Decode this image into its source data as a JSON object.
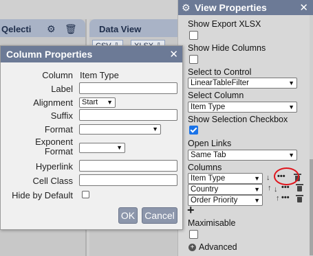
{
  "left_panel": {
    "fragment_text": "Qelecti"
  },
  "data_view": {
    "title": "Data View",
    "buttons": [
      "CSV ⇩",
      "XLSX ⇩"
    ]
  },
  "view_properties": {
    "title": "View Properties",
    "show_export_xlsx": {
      "label": "Show Export XLSX",
      "checked": false
    },
    "show_hide_columns": {
      "label": "Show Hide Columns",
      "checked": false
    },
    "select_to_control": {
      "label": "Select to Control",
      "value": "LinearTableFilter"
    },
    "select_column": {
      "label": "Select Column",
      "value": "Item Type"
    },
    "show_selection_checkbox": {
      "label": "Show Selection Checkbox",
      "checked": true
    },
    "open_links": {
      "label": "Open Links",
      "value": "Same Tab"
    },
    "columns": {
      "label": "Columns",
      "items": [
        {
          "value": "Item Type"
        },
        {
          "value": "Country"
        },
        {
          "value": "Order Priority"
        }
      ]
    },
    "maximisable": {
      "label": "Maximisable",
      "checked": false
    },
    "advanced": {
      "label": "Advanced"
    },
    "annotation_color": "#e0141c",
    "header_color": "#6c7a96"
  },
  "column_properties": {
    "title": "Column Properties",
    "column": {
      "label": "Column",
      "value": "Item Type"
    },
    "label": {
      "label": "Label",
      "value": ""
    },
    "alignment": {
      "label": "Alignment",
      "value": "Start"
    },
    "suffix": {
      "label": "Suffix",
      "value": ""
    },
    "format": {
      "label": "Format",
      "value": ""
    },
    "exponent_format": {
      "label_line1": "Exponent",
      "label_line2": "Format",
      "value": ""
    },
    "hyperlink": {
      "label": "Hyperlink",
      "value": ""
    },
    "cell_class": {
      "label": "Cell Class",
      "value": ""
    },
    "hide_by_default": {
      "label": "Hide by Default",
      "checked": false
    },
    "ok_label": "OK",
    "cancel_label": "Cancel"
  }
}
